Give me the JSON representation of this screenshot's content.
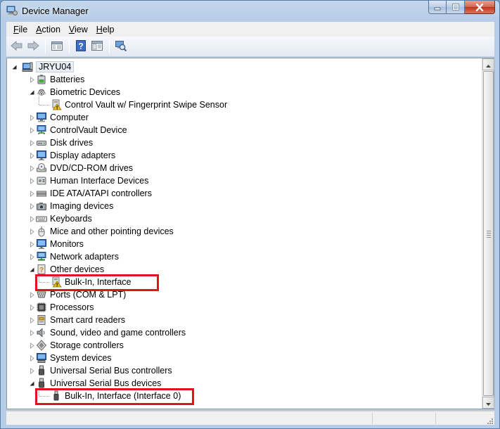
{
  "window": {
    "title": "Device Manager",
    "caption_icons": [
      "minimize-icon",
      "maximize-icon",
      "close-icon"
    ]
  },
  "menu": [
    {
      "key": "F",
      "rest": "ile"
    },
    {
      "key": "A",
      "rest": "ction"
    },
    {
      "key": "V",
      "rest": "iew"
    },
    {
      "key": "H",
      "rest": "elp"
    }
  ],
  "toolbar": [
    "back-arrow-icon",
    "forward-arrow-icon",
    "show-hide-console-tree-icon",
    "help-icon",
    "properties-icon",
    "scan-hardware-changes-icon"
  ],
  "tree": {
    "root": "JRYU04",
    "items": [
      {
        "label": "Batteries",
        "icon": "battery-icon",
        "expanded": false,
        "children": []
      },
      {
        "label": "Biometric Devices",
        "icon": "fingerprint-icon",
        "expanded": true,
        "children": [
          {
            "label": "Control Vault w/ Fingerprint Swipe Sensor",
            "icon": "warning-device-icon",
            "highlighted": false
          }
        ]
      },
      {
        "label": "Computer",
        "icon": "computer-icon",
        "expanded": false,
        "children": []
      },
      {
        "label": "ControlVault Device",
        "icon": "network-device-icon",
        "expanded": false,
        "children": []
      },
      {
        "label": "Disk drives",
        "icon": "disk-drive-icon",
        "expanded": false,
        "children": []
      },
      {
        "label": "Display adapters",
        "icon": "monitor-icon",
        "expanded": false,
        "children": []
      },
      {
        "label": "DVD/CD-ROM drives",
        "icon": "dvd-drive-icon",
        "expanded": false,
        "children": []
      },
      {
        "label": "Human Interface Devices",
        "icon": "hid-icon",
        "expanded": false,
        "children": []
      },
      {
        "label": "IDE ATA/ATAPI controllers",
        "icon": "ide-controller-icon",
        "expanded": false,
        "children": []
      },
      {
        "label": "Imaging devices",
        "icon": "camera-icon",
        "expanded": false,
        "children": []
      },
      {
        "label": "Keyboards",
        "icon": "keyboard-icon",
        "expanded": false,
        "children": []
      },
      {
        "label": "Mice and other pointing devices",
        "icon": "mouse-icon",
        "expanded": false,
        "children": []
      },
      {
        "label": "Monitors",
        "icon": "monitor-icon",
        "expanded": false,
        "children": []
      },
      {
        "label": "Network adapters",
        "icon": "network-adapter-icon",
        "expanded": false,
        "children": []
      },
      {
        "label": "Other devices",
        "icon": "unknown-device-icon",
        "expanded": true,
        "children": [
          {
            "label": "Bulk-In, Interface",
            "icon": "warning-device-icon",
            "highlighted": true
          }
        ]
      },
      {
        "label": "Ports (COM & LPT)",
        "icon": "port-icon",
        "expanded": false,
        "children": []
      },
      {
        "label": "Processors",
        "icon": "processor-icon",
        "expanded": false,
        "children": []
      },
      {
        "label": "Smart card readers",
        "icon": "smart-card-icon",
        "expanded": false,
        "children": []
      },
      {
        "label": "Sound, video and game controllers",
        "icon": "speaker-icon",
        "expanded": false,
        "children": []
      },
      {
        "label": "Storage controllers",
        "icon": "storage-controller-icon",
        "expanded": false,
        "children": []
      },
      {
        "label": "System devices",
        "icon": "system-device-icon",
        "expanded": false,
        "children": []
      },
      {
        "label": "Universal Serial Bus controllers",
        "icon": "usb-icon",
        "expanded": false,
        "children": []
      },
      {
        "label": "Universal Serial Bus devices",
        "icon": "usb-icon",
        "expanded": true,
        "children": [
          {
            "label": "Bulk-In, Interface (Interface 0)",
            "icon": "usb-plug-icon",
            "highlighted": true
          }
        ]
      }
    ]
  },
  "colors": {
    "highlight_box": "#e0141e",
    "warning": "#f2c200"
  }
}
